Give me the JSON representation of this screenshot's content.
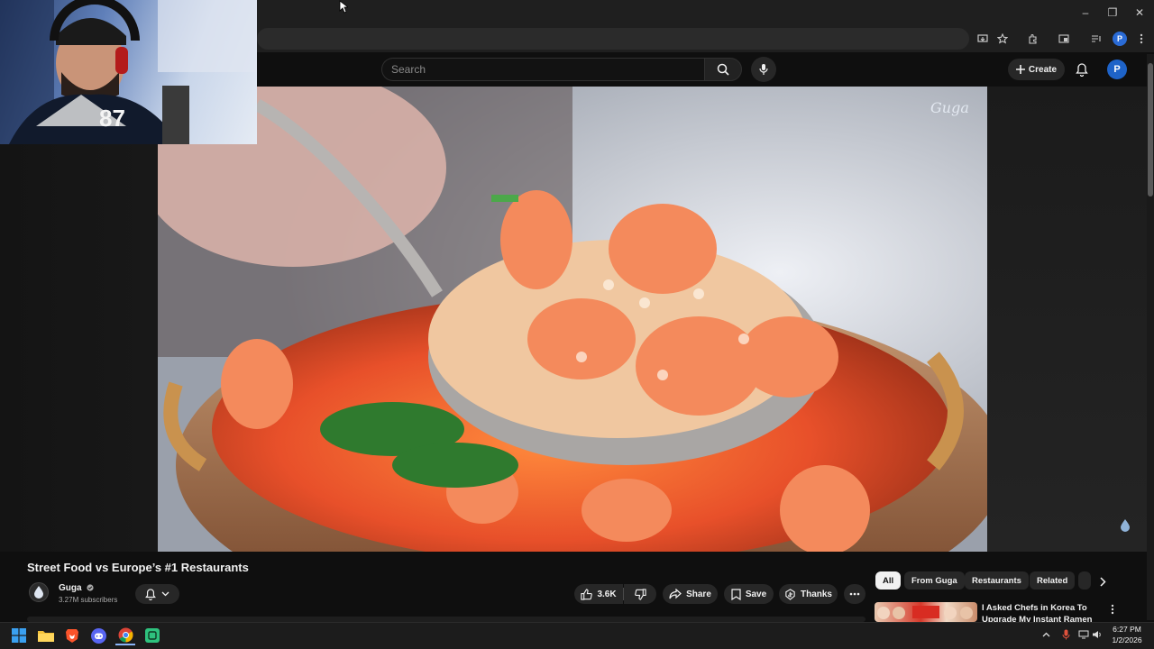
{
  "browser": {
    "window_controls": {
      "minimize": "–",
      "maximize": "❐",
      "close": "✕"
    },
    "profile_initial": "P"
  },
  "masthead": {
    "search_placeholder": "Search",
    "create_label": "Create",
    "avatar_initial": "P"
  },
  "video": {
    "title": "Street Food vs Europe’s #1 Restaurants",
    "watermark": "Guga"
  },
  "channel": {
    "name": "Guga",
    "subscribers": "3.27M subscribers"
  },
  "actions": {
    "like_count": "3.6K",
    "share_label": "Share",
    "save_label": "Save",
    "thanks_label": "Thanks"
  },
  "filter_chips": [
    {
      "label": "All",
      "active": true
    },
    {
      "label": "From Guga",
      "active": false
    },
    {
      "label": "Restaurants",
      "active": false
    },
    {
      "label": "Related",
      "active": false
    }
  ],
  "recommendation": {
    "title": "I Asked Chefs in Korea To Upgrade My Instant Ramen"
  },
  "taskbar": {
    "apps": [
      "windows-start",
      "file-explorer",
      "brave",
      "discord",
      "chrome",
      "app-green"
    ],
    "time": "6:27 PM",
    "date": "1/2/2026"
  },
  "colors": {
    "accent_blue": "#1e63c8",
    "page_bg": "#0f0f0f",
    "chip_bg": "#272727"
  }
}
